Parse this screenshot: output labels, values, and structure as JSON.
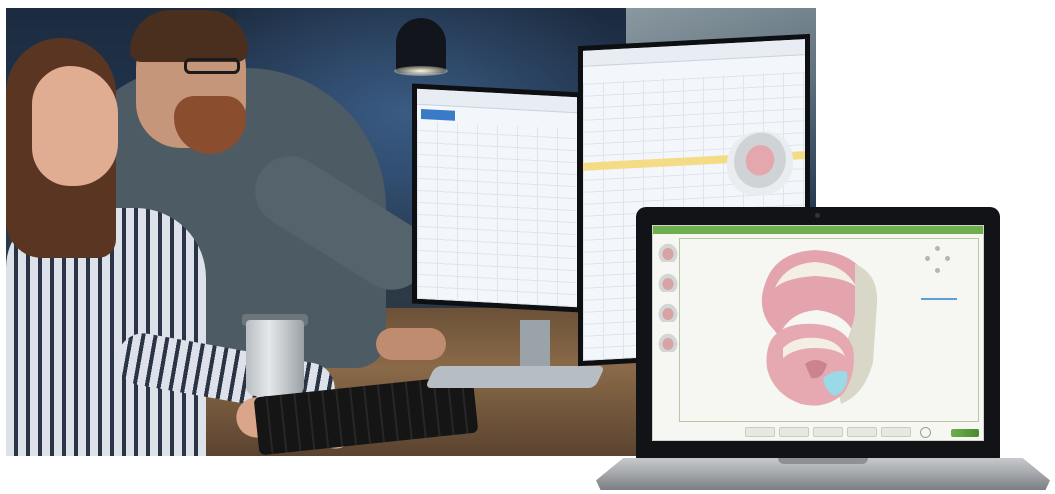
{
  "scene": {
    "photo": "office-photo",
    "devices": [
      "dual-monitor-workstation",
      "laptop"
    ]
  },
  "laptop_app": {
    "accent_color": "#6fae4e",
    "highlight_color": "#5c9fd8",
    "thumbnails": 4,
    "toolbar_buttons": 5
  },
  "colors": {
    "gum": "#e3a4ad",
    "tooth": "#f4efe6",
    "scan_highlight": "#9bd9e6"
  }
}
